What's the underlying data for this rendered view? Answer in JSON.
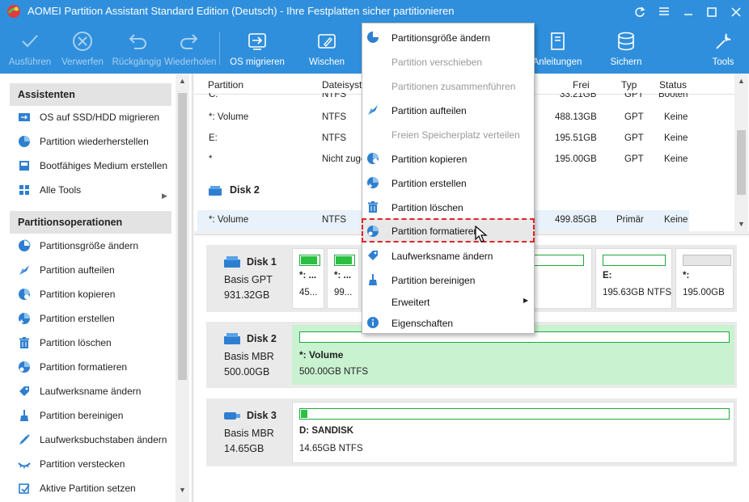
{
  "window": {
    "title": "AOMEI Partition Assistant Standard Edition (Deutsch) - Ihre Festplatten sicher partitionieren"
  },
  "toolbar": {
    "buttons": [
      {
        "label": "Ausführen",
        "icon": "check-icon",
        "enabled": false
      },
      {
        "label": "Verwerfen",
        "icon": "discard-icon",
        "enabled": false
      },
      {
        "label": "Rückgängig",
        "icon": "undo-icon",
        "enabled": false
      },
      {
        "label": "Wiederholen",
        "icon": "redo-icon",
        "enabled": false
      },
      {
        "label": "OS migrieren",
        "icon": "migrate-os-icon",
        "enabled": true
      },
      {
        "label": "Wischen",
        "icon": "wipe-icon",
        "enabled": true
      },
      {
        "label": "Anleitungen",
        "icon": "book-icon",
        "enabled": true
      },
      {
        "label": "Sichern",
        "icon": "backup-icon",
        "enabled": true
      },
      {
        "label": "Tools",
        "icon": "tools-icon",
        "enabled": true
      }
    ]
  },
  "sidebar": {
    "assistants": {
      "title": "Assistenten",
      "items": [
        {
          "label": "OS auf SSD/HDD migrieren",
          "icon": "migrate-icon"
        },
        {
          "label": "Partition wiederherstellen",
          "icon": "recover-icon"
        },
        {
          "label": "Bootfähiges Medium erstellen",
          "icon": "bootable-media-icon"
        },
        {
          "label": "Alle Tools",
          "icon": "grid-icon"
        }
      ]
    },
    "operations": {
      "title": "Partitionsoperationen",
      "items": [
        {
          "label": "Partitionsgröße ändern",
          "icon": "resize-icon"
        },
        {
          "label": "Partition aufteilen",
          "icon": "split-icon"
        },
        {
          "label": "Partition kopieren",
          "icon": "copy-icon"
        },
        {
          "label": "Partition erstellen",
          "icon": "create-icon"
        },
        {
          "label": "Partition löschen",
          "icon": "trash-icon"
        },
        {
          "label": "Partition formatieren",
          "icon": "format-icon"
        },
        {
          "label": "Laufwerksname ändern",
          "icon": "label-tag-icon"
        },
        {
          "label": "Partition bereinigen",
          "icon": "broom-icon"
        },
        {
          "label": "Laufwerksbuchstaben ändern",
          "icon": "drive-letter-icon"
        },
        {
          "label": "Partition verstecken",
          "icon": "hide-eye-icon"
        },
        {
          "label": "Aktive Partition setzen",
          "icon": "set-active-icon"
        }
      ]
    }
  },
  "table": {
    "columns": {
      "partition": "Partition",
      "filesystem": "Dateisyste",
      "free": "Frei",
      "type": "Typ",
      "status": "Status"
    },
    "rows": [
      {
        "partition": "C:",
        "filesystem": "NTFS",
        "free": "33.21GB",
        "type": "GPT",
        "status": "Booten"
      },
      {
        "partition": "*: Volume",
        "filesystem": "NTFS",
        "free": "488.13GB",
        "type": "GPT",
        "status": "Keine"
      },
      {
        "partition": "E:",
        "filesystem": "NTFS",
        "free": "195.51GB",
        "type": "GPT",
        "status": "Keine"
      },
      {
        "partition": "*",
        "filesystem": "Nicht zuge",
        "free": "195.00GB",
        "type": "GPT",
        "status": "Keine"
      }
    ],
    "disk2_label": "Disk 2",
    "disk2_rows": [
      {
        "partition": "*: Volume",
        "filesystem": "NTFS",
        "free": "499.85GB",
        "type": "Primär",
        "status": "Keine"
      }
    ]
  },
  "diskmap": {
    "disks": [
      {
        "name": "Disk 1",
        "kind": "Basis GPT",
        "size": "931.32GB",
        "partitions": [
          {
            "name": "*: ...",
            "info": "45...",
            "fill": 0.9
          },
          {
            "name": "*: ...",
            "info": "99...",
            "fill": 0.9
          },
          {
            "name": "",
            "info": "",
            "fill": 0.0
          },
          {
            "name": "E:",
            "info": "195.63GB NTFS",
            "fill": 0.0
          },
          {
            "name": "*:",
            "info": "195.00GB",
            "fill": 0.0,
            "unallocated": true
          }
        ]
      },
      {
        "name": "Disk 2",
        "kind": "Basis MBR",
        "size": "500.00GB",
        "partitions": [
          {
            "name": "*: Volume",
            "info": "500.00GB NTFS",
            "fill": 0.0,
            "selected": true
          }
        ]
      },
      {
        "name": "Disk 3",
        "kind": "Basis MBR",
        "size": "14.65GB",
        "partitions": [
          {
            "name": "D: SANDISK",
            "info": "14.65GB NTFS",
            "fill": 0.01
          }
        ]
      }
    ]
  },
  "context_menu": {
    "items": [
      {
        "label": "Partitionsgröße ändern",
        "icon": "resize-icon",
        "enabled": true
      },
      {
        "label": "Partition verschieben",
        "icon": "",
        "enabled": false
      },
      {
        "label": "Partitionen zusammenführen",
        "icon": "",
        "enabled": false
      },
      {
        "label": "Partition aufteilen",
        "icon": "split-icon",
        "enabled": true
      },
      {
        "label": "Freien Speicherplatz verteilen",
        "icon": "",
        "enabled": false
      },
      {
        "label": "Partition kopieren",
        "icon": "copy-icon",
        "enabled": true
      },
      {
        "label": "Partition erstellen",
        "icon": "create-icon",
        "enabled": true
      },
      {
        "label": "Partition löschen",
        "icon": "trash-icon",
        "enabled": true
      },
      {
        "label": "Partition formatieren",
        "icon": "format-icon",
        "enabled": true,
        "highlighted": true
      },
      {
        "label": "Laufwerksname ändern",
        "icon": "label-tag-icon",
        "enabled": true
      },
      {
        "label": "Partition bereinigen",
        "icon": "broom-icon",
        "enabled": true
      },
      {
        "label": "Erweitert",
        "icon": "",
        "enabled": true,
        "submenu": true
      },
      {
        "label": "Eigenschaften",
        "icon": "info-icon",
        "enabled": true
      }
    ]
  },
  "colors": {
    "toolbar_blue": "#2f8fdc",
    "partition_green": "#2cc042",
    "selected_partition": "#c9f2d0",
    "highlight_red": "#e0232b"
  }
}
